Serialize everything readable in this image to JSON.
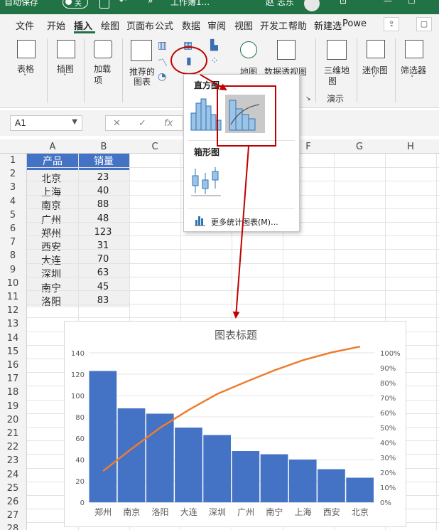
{
  "titlebar": {
    "autosave_label": "自动保存",
    "toggle_state": "关",
    "workbook_name": "工作簿1...",
    "user_name": "赵 志东",
    "more_glyph": "»"
  },
  "menu": {
    "tabs": [
      "文件",
      "开始",
      "插入",
      "绘图",
      "页面布",
      "公式",
      "数据",
      "审阅",
      "视图",
      "开发工",
      "帮助",
      "新建选",
      "Powe"
    ],
    "active_tab": "插入"
  },
  "ribbon": {
    "table_label": "表格",
    "illustration_label": "插图",
    "addin_label_1": "加载",
    "addin_label_2": "项",
    "recommended_label_1": "推荐的",
    "recommended_label_2": "图表",
    "map_label": "地图",
    "pivotchart_label": "数据透视图",
    "map3d_label_1": "三维地",
    "map3d_label_2": "图",
    "tour_group_label": "演示",
    "sparkline_label": "迷你图",
    "filter_label": "筛选器"
  },
  "formula_bar": {
    "name_box": "A1",
    "cancel_glyph": "✕",
    "enter_glyph": "✓",
    "fx_glyph": "fx"
  },
  "grid": {
    "columns": [
      "A",
      "B",
      "C",
      "D",
      "E",
      "F",
      "G",
      "H"
    ],
    "rows": [
      "1",
      "2",
      "3",
      "4",
      "5",
      "6",
      "7",
      "8",
      "9",
      "10",
      "11",
      "12",
      "13",
      "14",
      "15",
      "16",
      "17",
      "18",
      "19",
      "20",
      "21",
      "22",
      "23",
      "24",
      "25",
      "26",
      "27",
      "28"
    ],
    "header_product": "产品",
    "header_sales": "销量",
    "products": [
      "北京",
      "上海",
      "南京",
      "广州",
      "郑州",
      "西安",
      "大连",
      "深圳",
      "南宁",
      "洛阳"
    ],
    "sales": [
      23,
      40,
      88,
      48,
      123,
      31,
      70,
      63,
      45,
      83
    ]
  },
  "dropdown": {
    "histogram_section": "直方图",
    "boxplot_section": "箱形图",
    "more_charts": "更多统计图表(M)..."
  },
  "colors": {
    "excel_green": "#217346",
    "bar_blue": "#4472c4",
    "line_orange": "#ed7d31",
    "highlight_red": "#c00000"
  },
  "chart_data": {
    "type": "bar",
    "title": "图表标题",
    "categories": [
      "郑州",
      "南京",
      "洛阳",
      "大连",
      "深圳",
      "广州",
      "南宁",
      "上海",
      "西安",
      "北京"
    ],
    "values": [
      123,
      88,
      83,
      70,
      63,
      48,
      45,
      40,
      31,
      23
    ],
    "cumulative_percent": [
      20.9,
      35.8,
      49.9,
      61.8,
      72.5,
      80.6,
      88.3,
      95.1,
      100.3,
      104.2
    ],
    "primary_axis": {
      "min": 0,
      "max": 140,
      "step": 20,
      "ticks": [
        "0",
        "20",
        "40",
        "60",
        "80",
        "100",
        "120",
        "140"
      ]
    },
    "secondary_axis": {
      "ticks": [
        "0%",
        "10%",
        "20%",
        "30%",
        "40%",
        "50%",
        "60%",
        "70%",
        "80%",
        "90%",
        "100%"
      ]
    },
    "grid": true
  }
}
